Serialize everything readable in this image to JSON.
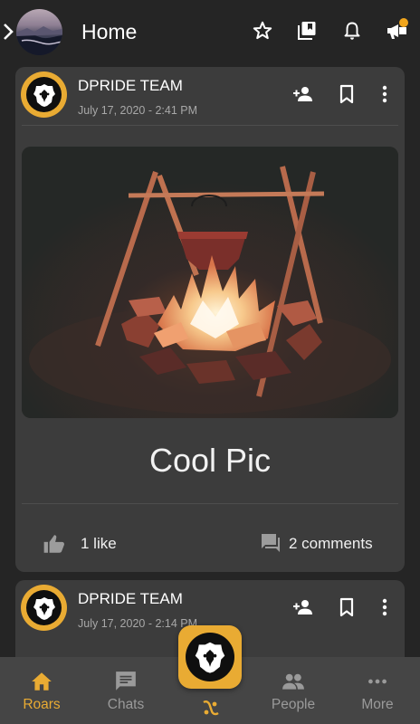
{
  "header": {
    "title": "Home",
    "icons": [
      "chevron-right-icon",
      "avatar",
      "star-icon",
      "library-icon",
      "bell-icon",
      "megaphone-icon"
    ]
  },
  "posts": [
    {
      "author": "DPRIDE TEAM",
      "date": "July 17, 2020 - 2:41 PM",
      "caption": "Cool Pic",
      "likes": "1 like",
      "comments": "2 comments"
    },
    {
      "author": "DPRIDE TEAM",
      "date": "July 17, 2020 - 2:14 PM"
    }
  ],
  "nav": {
    "items": [
      {
        "label": "Roars",
        "icon": "home-icon",
        "active": true
      },
      {
        "label": "Chats",
        "icon": "chat-icon",
        "active": false
      },
      {
        "label": "People",
        "icon": "people-icon",
        "active": false
      },
      {
        "label": "More",
        "icon": "more-icon",
        "active": false
      }
    ]
  },
  "colors": {
    "accent": "#e9ab33",
    "background": "#252525",
    "card": "#3c3c3c",
    "nav": "#454545"
  }
}
